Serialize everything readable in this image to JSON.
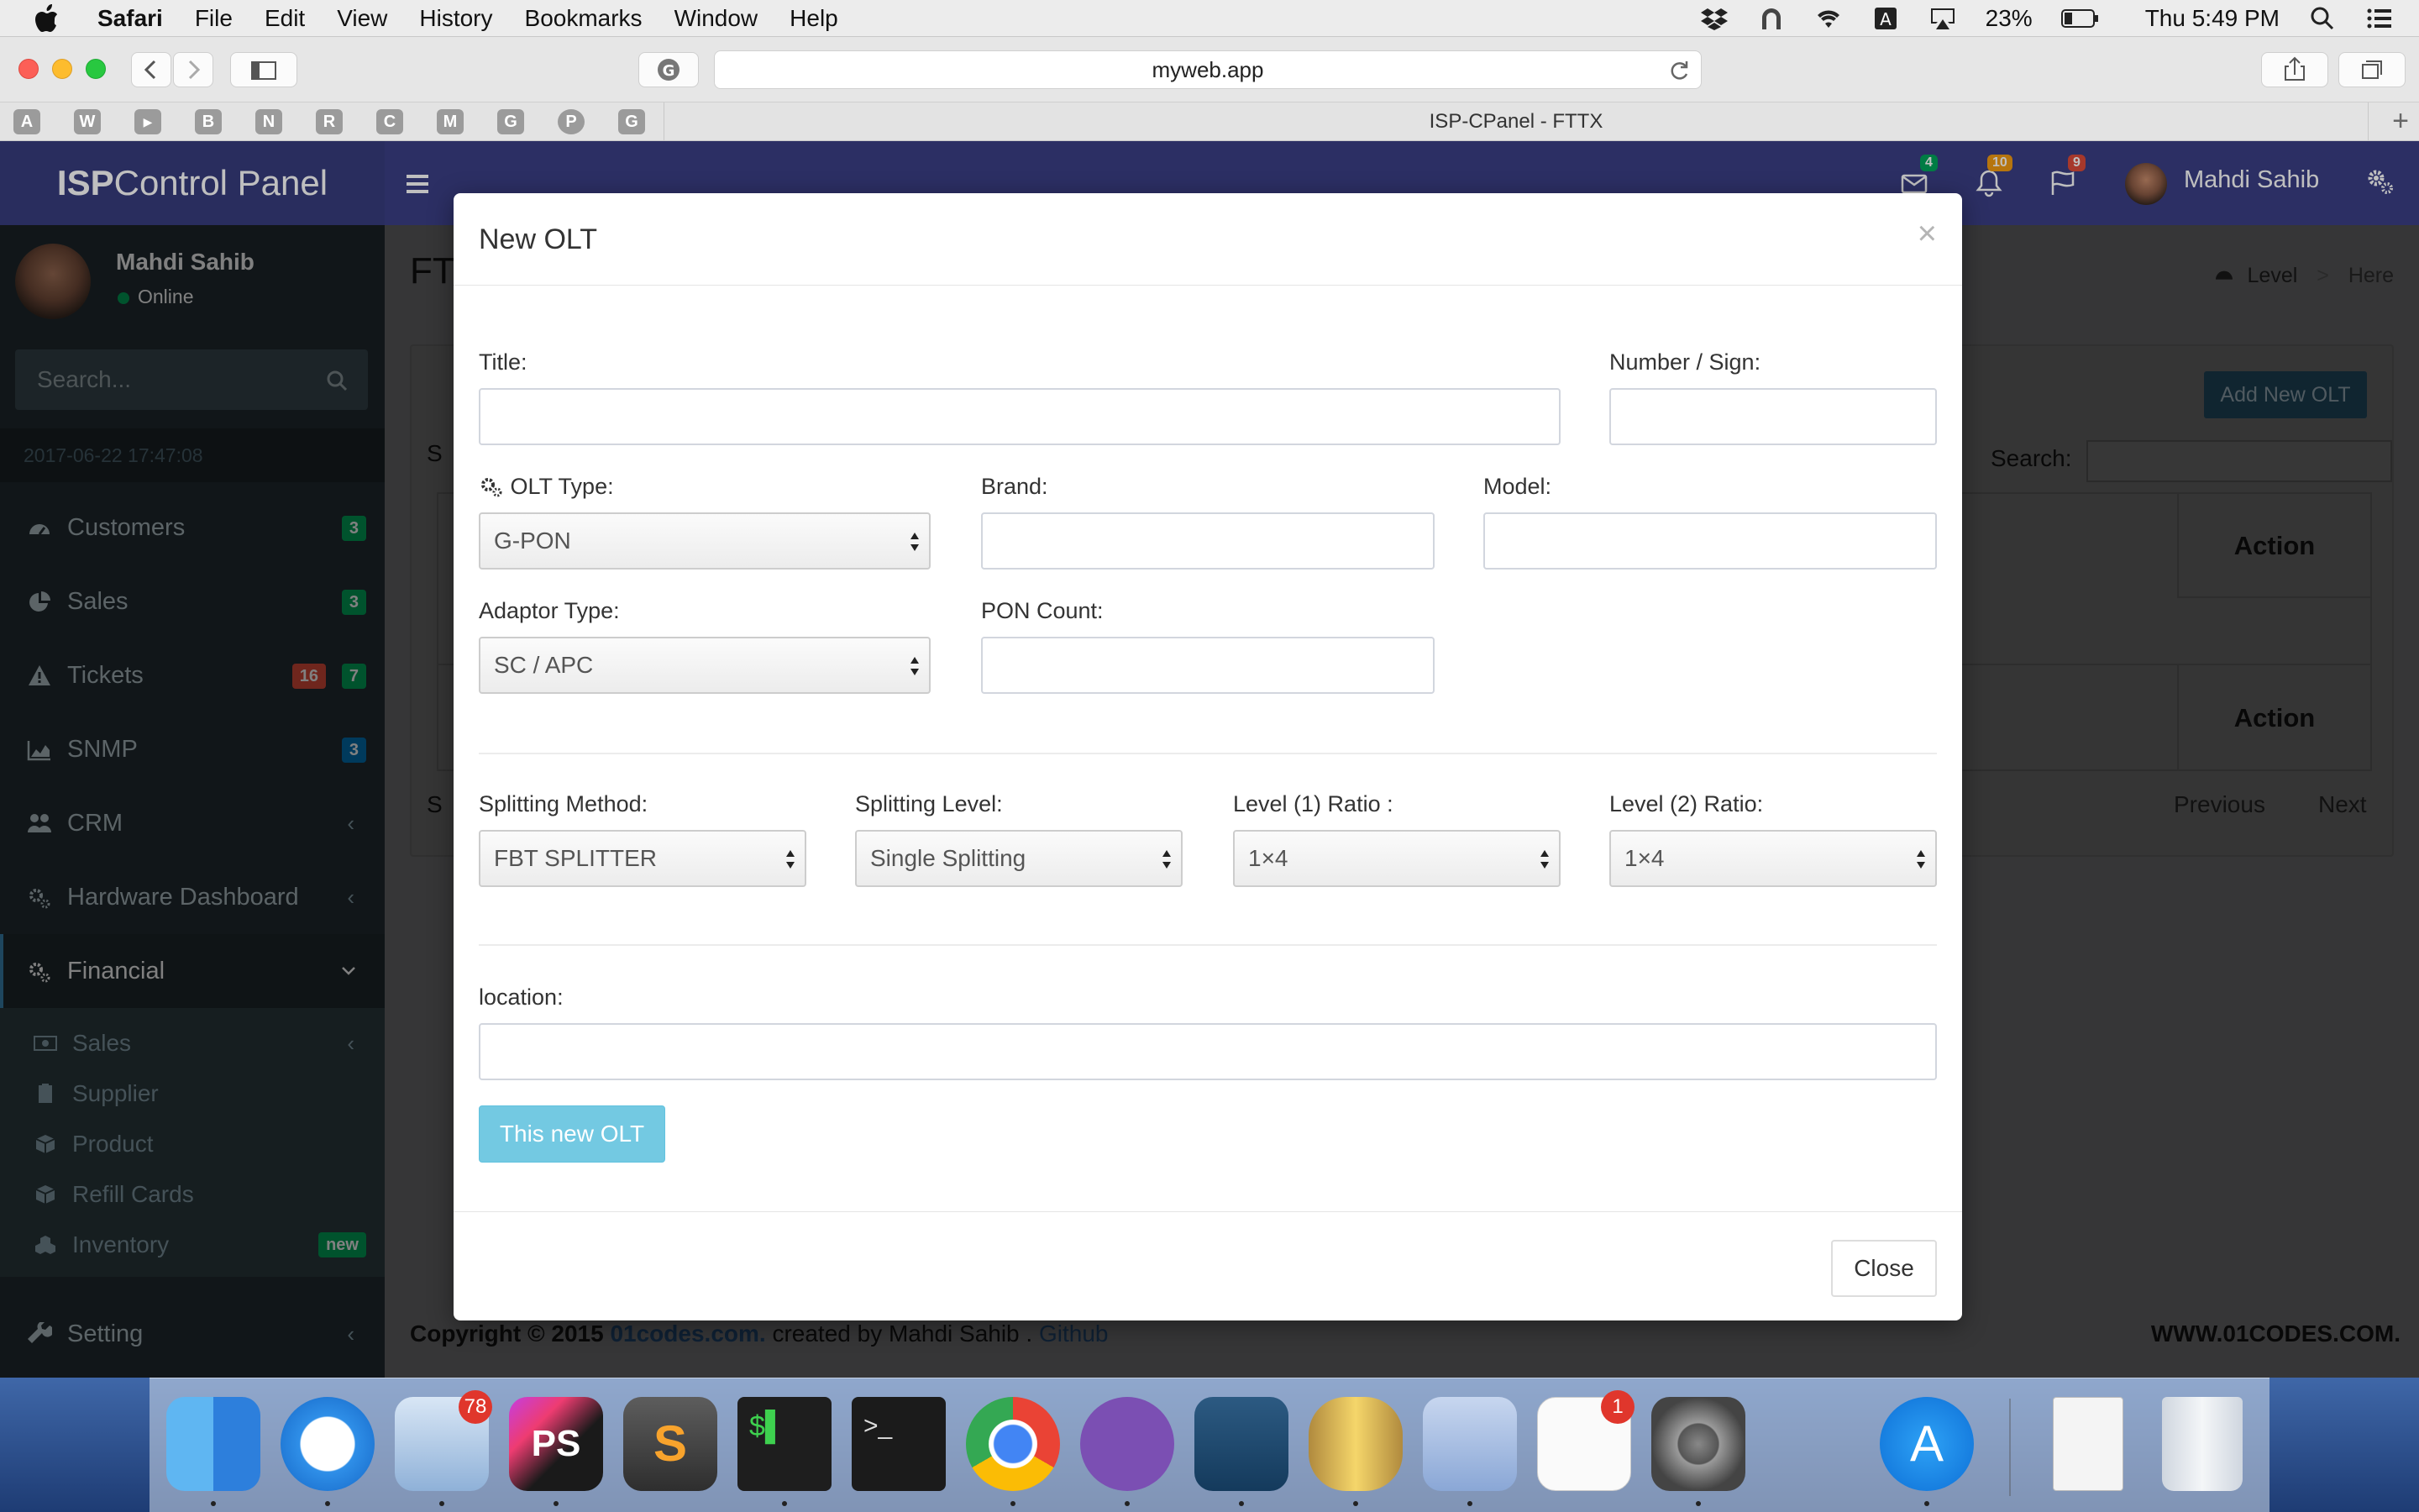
{
  "menubar": {
    "app": "Safari",
    "items": [
      "File",
      "Edit",
      "View",
      "History",
      "Bookmarks",
      "Window",
      "Help"
    ],
    "battery": "23%",
    "clock": "Thu 5:49 PM"
  },
  "browser": {
    "url": "myweb.app",
    "tab_title": "ISP-CPanel - FTTX",
    "favorites": [
      "A",
      "W",
      "",
      "B",
      "N",
      "R",
      "C",
      "M",
      "G",
      "",
      "G"
    ]
  },
  "header": {
    "logo_bold": "ISP",
    "logo_rest": "Control Panel",
    "mail_count": "4",
    "notif_count": "10",
    "flag_count": "9",
    "user_name": "Mahdi Sahib"
  },
  "sidebar": {
    "user_name": "Mahdi Sahib",
    "status": "Online",
    "search_placeholder": "Search...",
    "datetime": "2017-06-22 17:47:08",
    "items": [
      {
        "label": "Customers",
        "badges": [
          "3"
        ]
      },
      {
        "label": "Sales",
        "badges": [
          "3"
        ]
      },
      {
        "label": "Tickets",
        "badges": [
          "16",
          "7"
        ]
      },
      {
        "label": "SNMP",
        "badges": [
          "3"
        ]
      },
      {
        "label": "CRM"
      },
      {
        "label": "Hardware Dashboard"
      },
      {
        "label": "Financial"
      }
    ],
    "sub_items": [
      {
        "label": "Sales"
      },
      {
        "label": "Supplier"
      },
      {
        "label": "Product"
      },
      {
        "label": "Refill Cards"
      },
      {
        "label": "Inventory",
        "badge": "new"
      }
    ],
    "setting_label": "Setting"
  },
  "page": {
    "title_fragment": "FT",
    "breadcrumb_level": "Level",
    "breadcrumb_sep": ">",
    "breadcrumb_here": "Here",
    "add_button": "Add New OLT",
    "search_label": "Search:",
    "table_action_header": "Action",
    "table_action_footer": "Action",
    "show_fragment_top": "S",
    "show_fragment_bottom": "S",
    "previous": "Previous",
    "next": "Next",
    "footer_copyright": "Copyright © 2015",
    "footer_link": "01codes.com.",
    "footer_created": "created by Mahdi Sahib .",
    "footer_github": "Github",
    "footer_right": "WWW.01CODES.COM."
  },
  "modal": {
    "title": "New OLT",
    "close_x": "×",
    "title_label": "Title:",
    "number_label": "Number / Sign:",
    "olt_type_label": "OLT Type:",
    "olt_type_value": "G-PON",
    "brand_label": "Brand:",
    "model_label": "Model:",
    "adaptor_label": "Adaptor Type:",
    "adaptor_value": "SC / APC",
    "pon_count_label": "PON Count:",
    "splitting_method_label": "Splitting Method:",
    "splitting_method_value": "FBT SPLITTER",
    "splitting_level_label": "Splitting Level:",
    "splitting_level_value": "Single Splitting",
    "level1_label": "Level (1) Ratio :",
    "level1_value": "1×4",
    "level2_label": "Level (2) Ratio:",
    "level2_value": "1×4",
    "location_label": "location:",
    "submit_label": "This new OLT",
    "close_label": "Close"
  },
  "dock": {
    "mail_badge": "78",
    "reminders_badge": "1"
  },
  "colors": {
    "header": "#3a3f86",
    "sidebar": "#222d32",
    "accent_info": "#5bc0de",
    "add_button": "#3c8dbc"
  }
}
